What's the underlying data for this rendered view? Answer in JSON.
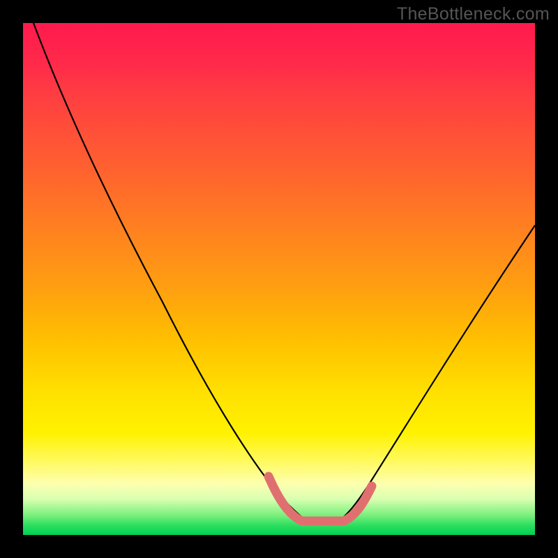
{
  "watermark": "TheBottleneck.com",
  "chart_data": {
    "type": "line",
    "title": "",
    "xlabel": "",
    "ylabel": "",
    "xlim": [
      0,
      100
    ],
    "ylim": [
      0,
      100
    ],
    "series": [
      {
        "name": "bottleneck-curve",
        "x": [
          2,
          10,
          20,
          30,
          40,
          48,
          52,
          56,
          60,
          64,
          70,
          80,
          90,
          100
        ],
        "values": [
          100,
          84,
          66,
          48,
          30,
          12,
          3,
          0,
          0,
          3,
          14,
          34,
          53,
          66
        ]
      }
    ],
    "highlight": {
      "name": "optimal-range",
      "x": [
        48,
        52,
        56,
        60,
        64
      ],
      "values": [
        12,
        3,
        0,
        0,
        3
      ],
      "color": "#e07070"
    },
    "background_gradient": {
      "top": "#ff1a4d",
      "middle": "#ffe000",
      "bottom": "#00d050"
    }
  }
}
